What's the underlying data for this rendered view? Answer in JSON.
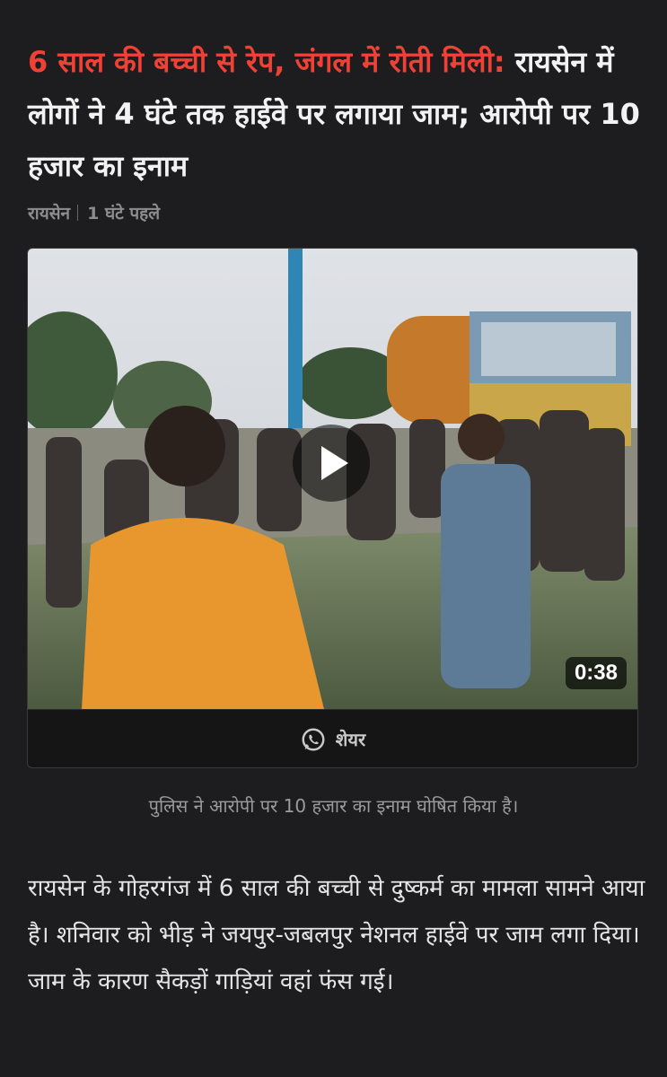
{
  "article": {
    "headline_accent": "6 साल की बच्ची से रेप, जंगल में रोती मिली:",
    "headline_rest": "रायसेन में लोगों ने 4 घंटे तक हाईवे पर लगाया जाम; आरोपी पर 10 हजार का इनाम",
    "location": "रायसेन",
    "time_ago": "1 घंटे पहले",
    "accent_color": "#ef4136"
  },
  "video": {
    "duration": "0:38",
    "share_label": "शेयर",
    "play_icon": "play-icon",
    "share_icon": "whatsapp-icon"
  },
  "caption": "पुलिस ने आरोपी पर 10 हजार का इनाम घोषित किया है।",
  "body": "रायसेन के गोहरगंज में 6 साल की बच्ची से दुष्कर्म का मामला सामने आया है। शनिवार को भीड़ ने जयपुर-जबलपुर नेशनल हाईवे पर जाम लगा दिया। जाम के कारण सैकड़ों गाड़ियां वहां फंस गई।"
}
